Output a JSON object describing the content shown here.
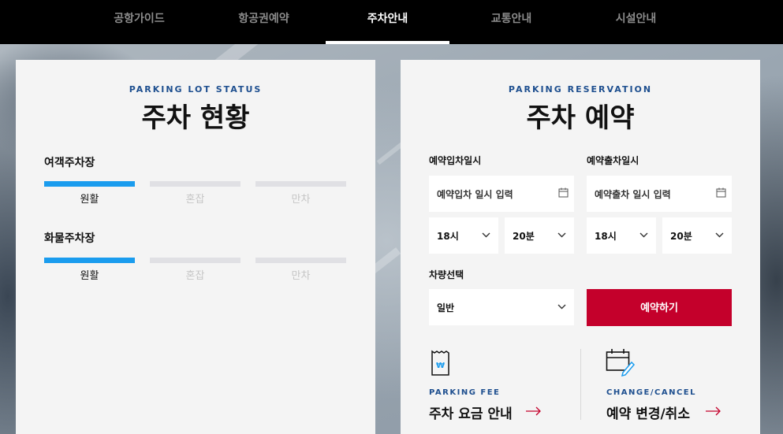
{
  "nav": {
    "items": [
      {
        "label": "공항가이드",
        "active": false
      },
      {
        "label": "항공권예약",
        "active": false
      },
      {
        "label": "주차안내",
        "active": true
      },
      {
        "label": "교통안내",
        "active": false
      },
      {
        "label": "시설안내",
        "active": false
      }
    ]
  },
  "status": {
    "eyebrow": "PARKING LOT STATUS",
    "title": "주차 현황",
    "lots": [
      {
        "name": "여객주차장",
        "levels": [
          "원활",
          "혼잡",
          "만차"
        ],
        "current": "원활"
      },
      {
        "name": "화물주차장",
        "levels": [
          "원활",
          "혼잡",
          "만차"
        ],
        "current": "원활"
      }
    ]
  },
  "reservation": {
    "eyebrow": "PARKING RESERVATION",
    "title": "주차 예약",
    "entry": {
      "label": "예약입차일시",
      "date_placeholder": "예약입차 일시 입력",
      "hour": "18시",
      "minute": "20분"
    },
    "exit": {
      "label": "예약출차일시",
      "date_placeholder": "예약출차 일시 입력",
      "hour": "18시",
      "minute": "20분"
    },
    "vehicle": {
      "label": "차량선택",
      "value": "일반"
    },
    "reserve_button": "예약하기",
    "links": [
      {
        "eyebrow": "PARKING FEE",
        "title": "주차 요금 안내",
        "icon": "receipt-won-icon"
      },
      {
        "eyebrow": "CHANGE/CANCEL",
        "title": "예약 변경/취소",
        "icon": "calendar-edit-icon"
      }
    ]
  },
  "colors": {
    "accent_blue": "#1a9cee",
    "eyebrow_blue": "#1e4f8f",
    "reserve_red": "#c4002b",
    "arrow_red": "#c4002b"
  }
}
